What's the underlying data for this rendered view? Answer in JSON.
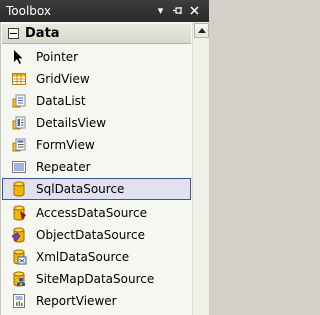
{
  "window": {
    "title": "Toolbox"
  },
  "titlebar_buttons": [
    {
      "name": "dropdown-icon",
      "glyph": "▾"
    },
    {
      "name": "pin-icon",
      "glyph": "⊣"
    },
    {
      "name": "close-icon",
      "glyph": "✕"
    }
  ],
  "category": {
    "label": "Data",
    "expanded": true
  },
  "items": [
    {
      "label": "Pointer",
      "icon": "pointer-icon",
      "selected": false
    },
    {
      "label": "GridView",
      "icon": "gridview-icon",
      "selected": false
    },
    {
      "label": "DataList",
      "icon": "datalist-icon",
      "selected": false
    },
    {
      "label": "DetailsView",
      "icon": "detailsview-icon",
      "selected": false
    },
    {
      "label": "FormView",
      "icon": "formview-icon",
      "selected": false
    },
    {
      "label": "Repeater",
      "icon": "repeater-icon",
      "selected": false
    },
    {
      "label": "SqlDataSource",
      "icon": "sqldatasource-icon",
      "selected": true
    },
    {
      "label": "AccessDataSource",
      "icon": "accessdatasource-icon",
      "selected": false
    },
    {
      "label": "ObjectDataSource",
      "icon": "objectdatasource-icon",
      "selected": false
    },
    {
      "label": "XmlDataSource",
      "icon": "xmldatasource-icon",
      "selected": false
    },
    {
      "label": "SiteMapDataSource",
      "icon": "sitemapdatasource-icon",
      "selected": false
    },
    {
      "label": "ReportViewer",
      "icon": "reportviewer-icon",
      "selected": false
    }
  ],
  "colors": {
    "titlebar": "#333333",
    "selection_border": "#3b52a6",
    "selection_fill": "#e0e3ee",
    "panel_background": "#f7f7f2"
  }
}
